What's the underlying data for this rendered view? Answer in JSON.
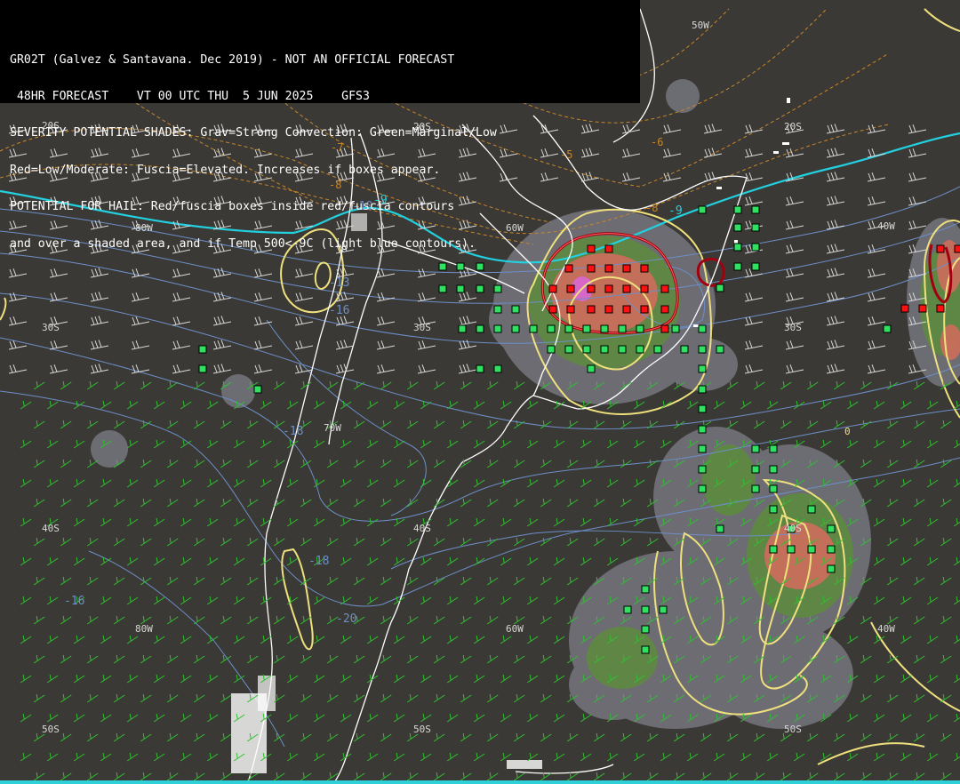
{
  "header": {
    "line1": "GR02T (Galvez & Santavana. Dec 2019) - NOT AN OFFICIAL FORECAST",
    "line2": " 48HR FORECAST    VT 00 UTC THU  5 JUN 2025    GFS3",
    "line3": "SEVERITY POTENTIAL SHADES: Grav=Strong Convection: Green=Marginal/Low",
    "line4": "Red=Low/Moderate: Fuscia=Elevated. Increases if boxes appear.",
    "line5": "POTENTIAL FOR HAIL: Red/fuscia boxes inside red/fuscia contours",
    "line6": "and over a shaded area, and if Temp 500<-9C (light blue contours)."
  },
  "grid_labels": {
    "lon_50w_top": "50W",
    "lat_20s_left": "20S",
    "lat_20s_mid": "20S",
    "lat_20s_right": "20S",
    "lon_80w_upper": "80W",
    "lon_60w_upper": "60W",
    "lon_40w_upper": "40W",
    "lat_30s_left": "30S",
    "lat_30s_mid": "30S",
    "lat_30s_right": "30S",
    "lon_70w_mid": "70W",
    "lat_40s_left": "40S",
    "lat_40s_mid": "40S",
    "lat_40s_right": "40S",
    "lon_80w_lower": "80W",
    "lon_60w_lower": "60W",
    "lon_40w_lower": "40W",
    "lat_50s_left": "50S",
    "lat_50s_mid": "50S",
    "lat_50s_right": "50S"
  },
  "contour_labels": {
    "temp_minus9_a": "-9",
    "temp_minus9_b": "-9",
    "temp_minus10": "-10",
    "temp_minus13": "-13",
    "temp_minus16_a": "-16",
    "temp_minus16_b": "-16",
    "temp_minus18_a": "-18",
    "temp_minus18_b": "-18",
    "temp_minus20": "-20",
    "warm_minus5": "-5",
    "warm_minus6": "-6",
    "warm_minus7": "-7",
    "warm_minus8_a": "-8",
    "warm_minus8_b": "-8",
    "yellow_zero": "0"
  },
  "colors": {
    "background": "#3b3935",
    "coastline": "#ffffff",
    "cyan_contour": "#22d0e0",
    "blue_contour": "#6c8fc8",
    "orange_dashed": "#c8862a",
    "yellow_contour": "#f0e080",
    "red_contour": "#b00010",
    "gray_shade": "#7a7a82",
    "green_shade": "#5c8a3c",
    "red_shade": "#c06a5a",
    "fuchsia_shade": "#d060c0",
    "green_box": "#30e060",
    "red_box": "#ff1010",
    "wind_barb": "#30c030"
  }
}
